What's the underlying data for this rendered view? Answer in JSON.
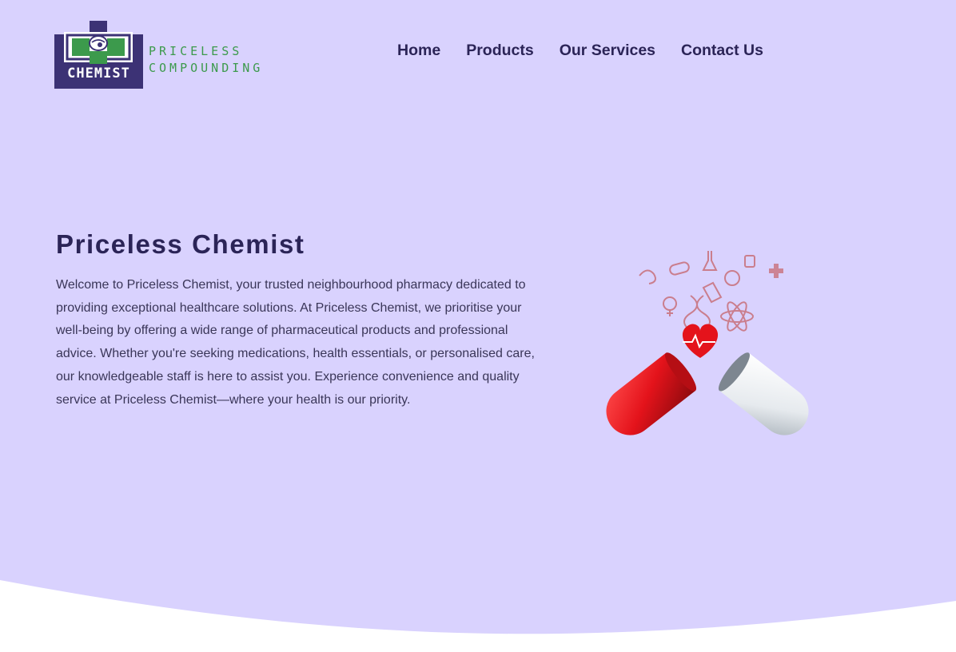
{
  "brand": {
    "badge_text": "CHEMIST",
    "line1": "PRICELESS",
    "line2": "COMPOUNDING",
    "badge_color": "#3c3275",
    "cross_color": "#3c9a4c"
  },
  "nav": {
    "items": [
      {
        "label": "Home"
      },
      {
        "label": "Products"
      },
      {
        "label": "Our Services"
      },
      {
        "label": "Contact Us"
      }
    ]
  },
  "hero": {
    "title": "Priceless Chemist",
    "text": "Welcome to Priceless Chemist, your trusted neighbourhood pharmacy dedicated to providing exceptional healthcare solutions. At Priceless Chemist, we prioritise your well-being by offering a wide range of pharmaceutical products and professional advice. Whether you're seeking medications, health essentials, or personalised care, our knowledgeable staff is here to assist you. Experience convenience and quality service at Priceless Chemist—where your health is our priority.",
    "illustration": "open-capsule-medical-icons"
  },
  "colors": {
    "background": "#d9d2fe",
    "heading": "#2b2457",
    "body_text": "#3a3658",
    "capsule_red": "#e4131b",
    "capsule_white": "#e9edf0"
  }
}
